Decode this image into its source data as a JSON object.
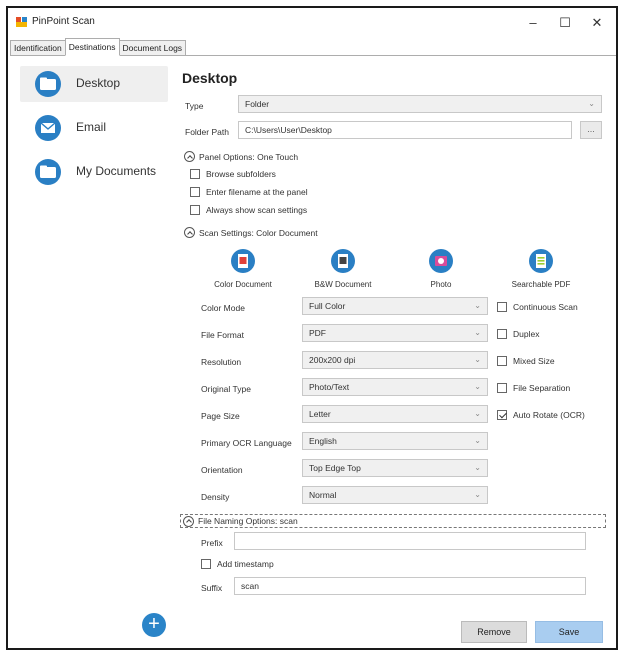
{
  "window": {
    "title": "PinPoint Scan",
    "controls": {
      "minimize": "–",
      "maximize": "☐",
      "close": "✕"
    }
  },
  "tabs": [
    {
      "label": "Identification",
      "active": false
    },
    {
      "label": "Destinations",
      "active": true
    },
    {
      "label": "Document Logs",
      "active": false
    }
  ],
  "nav": {
    "items": [
      {
        "label": "Desktop",
        "icon": "folder-icon",
        "selected": true
      },
      {
        "label": "Email",
        "icon": "envelope-icon",
        "selected": false
      },
      {
        "label": "My Documents",
        "icon": "folder-icon",
        "selected": false
      }
    ],
    "add_label": "+"
  },
  "detail": {
    "title": "Desktop",
    "type_label": "Type",
    "type_value": "Folder",
    "folder_path_label": "Folder Path",
    "folder_path_value": "C:\\Users\\User\\Desktop",
    "browse_label": "...",
    "panel_options": {
      "header": "Panel Options: One Touch",
      "options": [
        {
          "label": "Browse subfolders",
          "checked": false
        },
        {
          "label": "Enter filename at the panel",
          "checked": false
        },
        {
          "label": "Always show scan settings",
          "checked": false
        }
      ]
    },
    "scan_settings": {
      "header": "Scan Settings: Color Document",
      "doc_types": [
        {
          "label": "Color Document",
          "icon": "color-document-icon"
        },
        {
          "label": "B&W Document",
          "icon": "bw-document-icon"
        },
        {
          "label": "Photo",
          "icon": "photo-icon"
        },
        {
          "label": "Searchable PDF",
          "icon": "searchable-pdf-icon"
        }
      ],
      "settings": [
        {
          "label": "Color Mode",
          "value": "Full Color"
        },
        {
          "label": "File Format",
          "value": "PDF"
        },
        {
          "label": "Resolution",
          "value": "200x200 dpi"
        },
        {
          "label": "Original Type",
          "value": "Photo/Text"
        },
        {
          "label": "Page Size",
          "value": "Letter"
        },
        {
          "label": "Primary OCR Language",
          "value": "English"
        },
        {
          "label": "Orientation",
          "value": "Top Edge Top"
        },
        {
          "label": "Density",
          "value": "Normal"
        }
      ],
      "options": [
        {
          "label": "Continuous Scan",
          "checked": false
        },
        {
          "label": "Duplex",
          "checked": false
        },
        {
          "label": "Mixed Size",
          "checked": false
        },
        {
          "label": "File Separation",
          "checked": false
        },
        {
          "label": "Auto Rotate (OCR)",
          "checked": true
        }
      ]
    },
    "file_naming": {
      "header": "File Naming Options: scan",
      "prefix_label": "Prefix",
      "prefix_value": "",
      "timestamp_label": "Add timestamp",
      "timestamp_checked": false,
      "suffix_label": "Suffix",
      "suffix_value": "scan"
    },
    "buttons": {
      "remove": "Remove",
      "save": "Save"
    }
  },
  "colors": {
    "accent": "#2a84c8",
    "save_button": "#a9cdf0"
  }
}
